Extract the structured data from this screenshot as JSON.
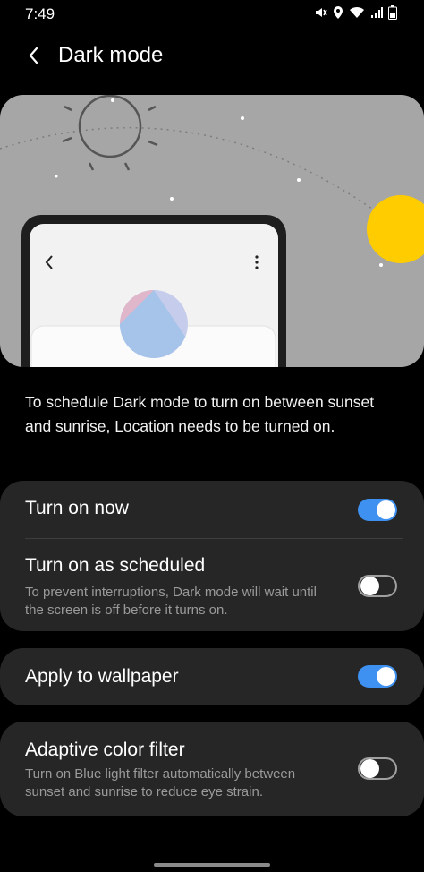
{
  "status_bar": {
    "time": "7:49",
    "icons": [
      "mute-icon",
      "location-icon",
      "wifi-icon",
      "signal-icon",
      "battery-icon"
    ]
  },
  "header": {
    "title": "Dark mode",
    "back_icon": "chevron-left-icon"
  },
  "description": "To schedule Dark mode to turn on between sunset and sunrise, Location needs to be turned on.",
  "settings": {
    "turn_on_now": {
      "title": "Turn on now",
      "enabled": true
    },
    "turn_on_scheduled": {
      "title": "Turn on as scheduled",
      "subtitle": "To prevent interruptions, Dark mode will wait until the screen is off before it turns on.",
      "enabled": false
    },
    "apply_wallpaper": {
      "title": "Apply to wallpaper",
      "enabled": true
    },
    "adaptive_color": {
      "title": "Adaptive color filter",
      "subtitle": "Turn on Blue light filter automatically between sunset and sunrise to reduce eye strain.",
      "enabled": false
    }
  },
  "colors": {
    "accent": "#3e91f0",
    "card_bg": "#262626",
    "illustration_bg": "#a6a6a6",
    "sun": "#ffcc00"
  }
}
